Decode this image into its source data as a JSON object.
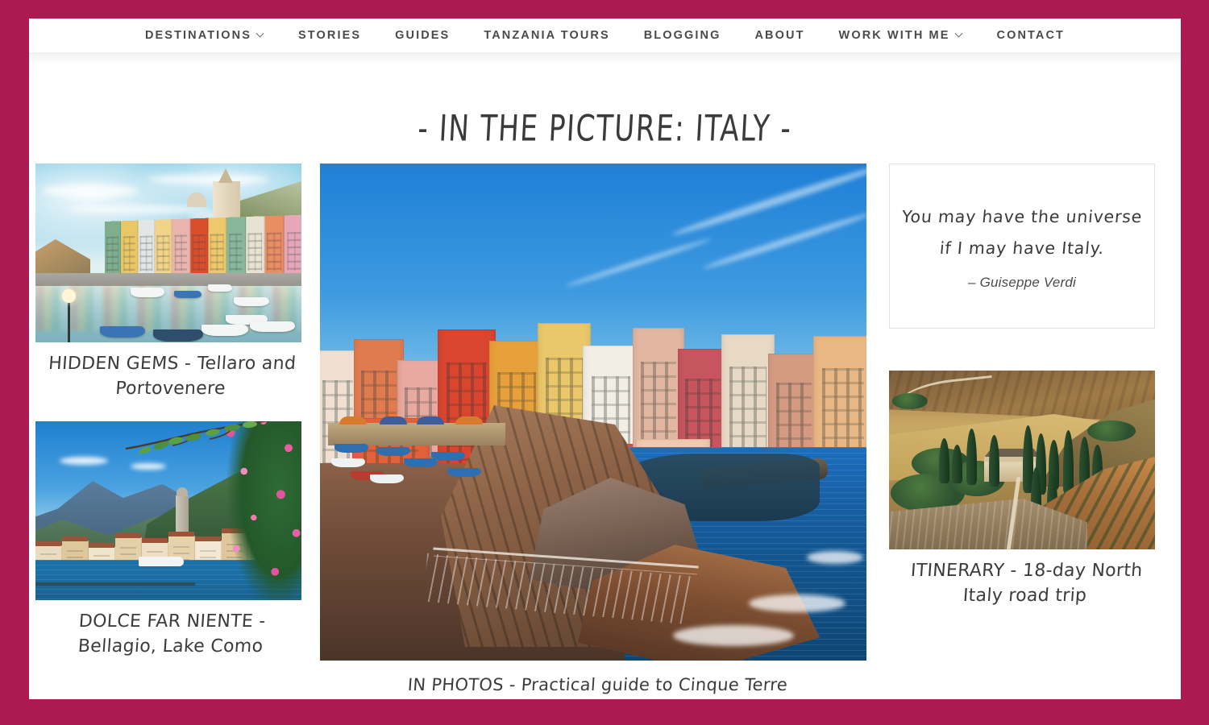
{
  "theme": {
    "border_color": "#ad1a51",
    "page_background": "#ffffff",
    "text_color": "#3c3c3c",
    "nav_text_color": "#4a4a4a"
  },
  "nav": {
    "items": [
      {
        "label": "DESTINATIONS",
        "has_dropdown": true,
        "icon": "chevron-down-icon"
      },
      {
        "label": "STORIES",
        "has_dropdown": false,
        "icon": ""
      },
      {
        "label": "GUIDES",
        "has_dropdown": false,
        "icon": ""
      },
      {
        "label": "TANZANIA TOURS",
        "has_dropdown": false,
        "icon": ""
      },
      {
        "label": "BLOGGING",
        "has_dropdown": false,
        "icon": ""
      },
      {
        "label": "ABOUT",
        "has_dropdown": false,
        "icon": ""
      },
      {
        "label": "WORK WITH ME",
        "has_dropdown": true,
        "icon": "chevron-down-icon"
      },
      {
        "label": "CONTACT",
        "has_dropdown": false,
        "icon": ""
      }
    ]
  },
  "main": {
    "title": "- IN THE PICTURE: ITALY -",
    "cards": {
      "hidden_gems": {
        "caption": "HIDDEN GEMS - Tellaro and Portovenere",
        "image_alt": "Portovenere harbour with colourful houses and boats"
      },
      "dolce_far_niente": {
        "caption": "DOLCE FAR NIENTE - Bellagio, Lake Como",
        "image_alt": "Bellagio lakeside town on Lake Como framed by pink flowers"
      },
      "in_photos": {
        "caption": "IN PHOTOS - Practical guide to Cinque Terre",
        "image_alt": "Manarola colourful cliffside village, Cinque Terre"
      },
      "itinerary": {
        "caption": "ITINERARY - 18-day North Italy road trip",
        "image_alt": "Tuscan farmhouse with cypress trees on golden hills"
      }
    },
    "quote": {
      "line1": "You may have the universe",
      "line2": "if I may have Italy.",
      "author": "– Guiseppe Verdi"
    }
  }
}
